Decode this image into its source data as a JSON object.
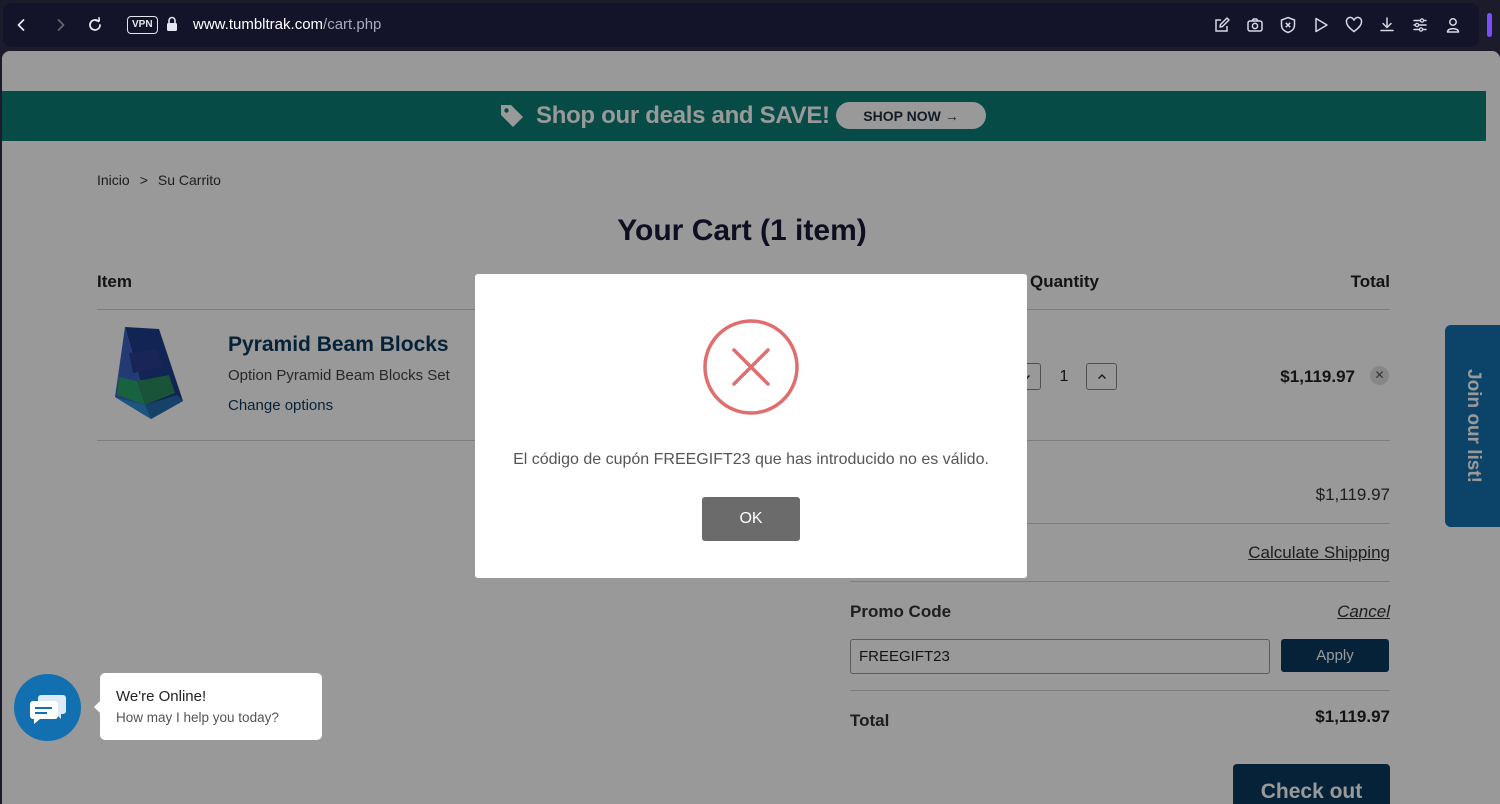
{
  "browser": {
    "vpn_label": "VPN",
    "url_domain": "www.tumbltrak.com",
    "url_path": "/cart.php",
    "toolbar_icons": [
      "edit-icon",
      "camera-icon",
      "shield-x-icon",
      "play-icon",
      "heart-icon",
      "download-icon",
      "menu-lines-icon",
      "account-icon"
    ]
  },
  "banner": {
    "text": "Shop our deals and SAVE!",
    "button_label": "SHOP NOW →",
    "color": "#0a7e76"
  },
  "breadcrumb": {
    "home": "Inicio",
    "separator": ">",
    "current": "Su Carrito"
  },
  "cart": {
    "title": "Your Cart (1 item)",
    "headers": {
      "item": "Item",
      "quantity": "Quantity",
      "total": "Total"
    },
    "item": {
      "name": "Pyramid Beam Blocks",
      "option": "Option  Pyramid Beam Blocks Set",
      "change_options": "Change options",
      "quantity": "1",
      "line_total": "$1,119.97"
    }
  },
  "summary": {
    "subtotal_value": "$1,119.97",
    "shipping_link": "Calculate Shipping",
    "promo_label": "Promo Code",
    "promo_cancel": "Cancel",
    "promo_value": "FREEGIFT23",
    "apply_label": "Apply",
    "total_label": "Total",
    "total_value": "$1,119.97",
    "checkout_label": "Check out"
  },
  "join_tab": {
    "label": "Join our list!"
  },
  "modal": {
    "message": "El código de cupón FREEGIFT23 que has introducido no es válido.",
    "ok_label": "OK",
    "icon": "error-x-circle-icon",
    "icon_color": "#e06e6e"
  },
  "chat": {
    "title": "We're Online!",
    "subtitle": "How may I help you today?"
  },
  "colors": {
    "brand_navy": "#0a3a5e",
    "brand_blue": "#1370b0",
    "banner_teal": "#0a7e76"
  }
}
